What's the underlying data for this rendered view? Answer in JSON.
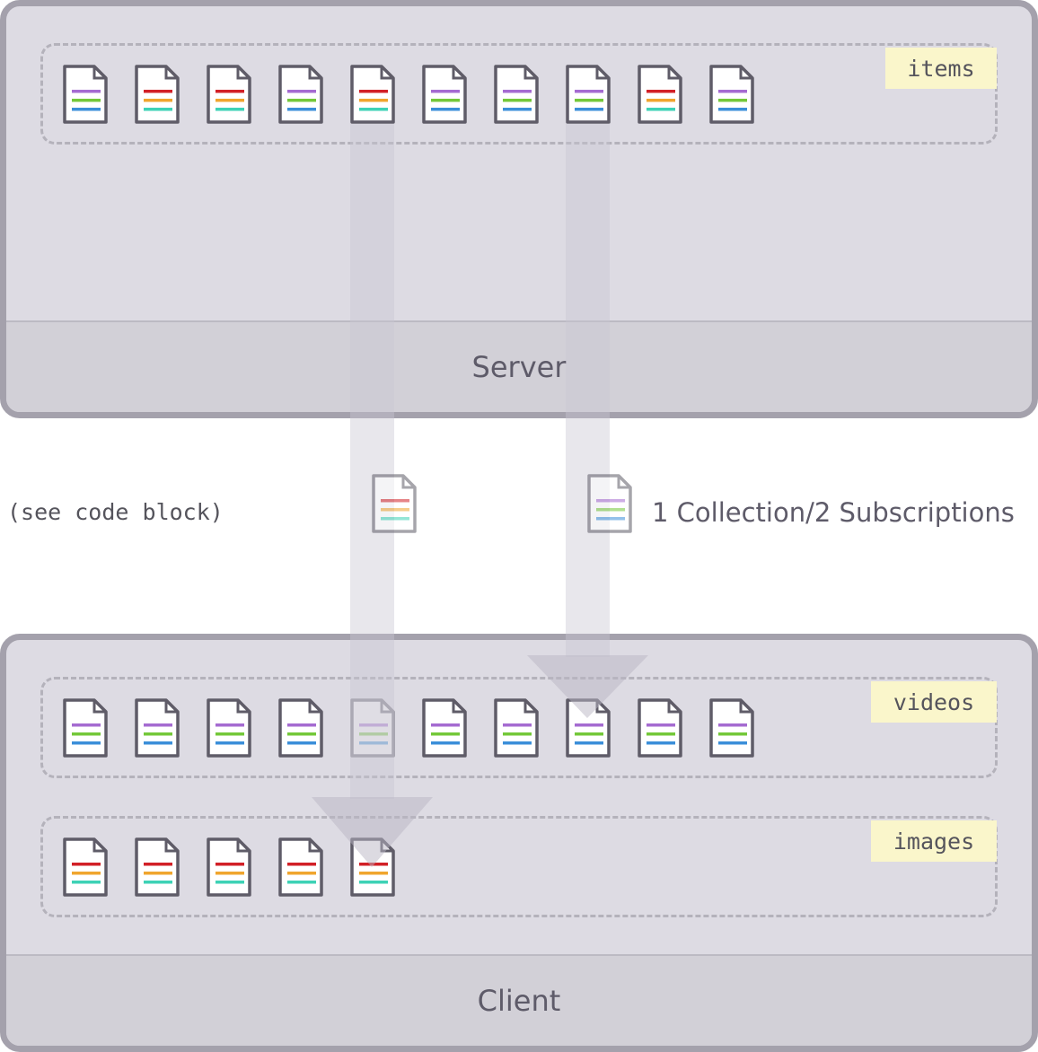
{
  "server": {
    "label": "Server",
    "collection": {
      "tag": "items",
      "docs": [
        "purple",
        "red",
        "red",
        "purple",
        "red",
        "purple",
        "purple",
        "purple",
        "red",
        "purple"
      ]
    }
  },
  "client": {
    "label": "Client",
    "collections": [
      {
        "tag": "videos",
        "docs": [
          "purple",
          "purple",
          "purple",
          "purple",
          "purple",
          "purple",
          "purple",
          "purple",
          "purple",
          "purple"
        ]
      },
      {
        "tag": "images",
        "docs": [
          "red",
          "red",
          "red",
          "red",
          "red"
        ]
      }
    ]
  },
  "captions": {
    "left": "(see code block)",
    "right": "1 Collection/2 Subscriptions"
  },
  "colors": {
    "doc_type_purple": [
      "#a56bd1",
      "#74c83a",
      "#3b8fd9"
    ],
    "doc_type_red": [
      "#d22027",
      "#f0a52e",
      "#3ed2b6"
    ],
    "panel_border": "#a4a1ac",
    "panel_fill": "#dddbe3",
    "tag_fill": "#faf6cb"
  }
}
